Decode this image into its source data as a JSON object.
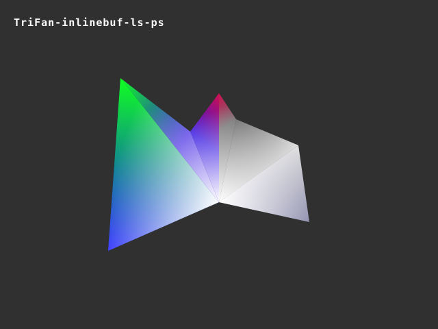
{
  "title": "TriFan-inlinebuf-ls-ps",
  "colors": {
    "background": "#303030",
    "center": "#ffffff",
    "v1": "#1010ff",
    "v2": "#10ff20",
    "v3": "#3010e0",
    "v4": "#d01050",
    "v5": "#707070",
    "v6": "#e0e0e0",
    "v7": "#9090b0"
  }
}
